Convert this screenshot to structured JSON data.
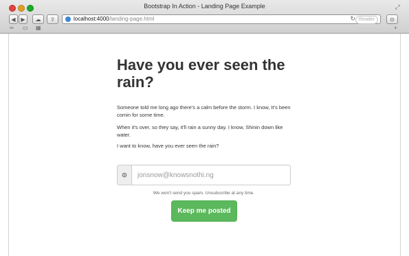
{
  "window": {
    "title": "Bootstrap In Action - Landing Page Example"
  },
  "toolbar": {
    "back_icon": "chevron-left-icon",
    "forward_icon": "chevron-right-icon",
    "url_host": "localhost:4000",
    "url_path": "/landing-page.html",
    "reader_label": "Reader",
    "reload_icon": "reload-icon"
  },
  "content": {
    "headline": "Have you ever seen the rain?",
    "paragraphs": [
      "Someone told me long ago there's a calm before the storm. I know, It's been comin for some time.",
      "When it's over, so they say, it'll rain a sunny day. I know, Shinin down like water.",
      "I want to know, have you ever seen the rain?"
    ],
    "email_placeholder": "jonsnow@knowsnothi.ng",
    "spam_note": "We won't send you spam. Unsubscribe at any time.",
    "cta_label": "Keep me posted"
  },
  "colors": {
    "cta": "#5cb85c",
    "headline": "#333333"
  }
}
